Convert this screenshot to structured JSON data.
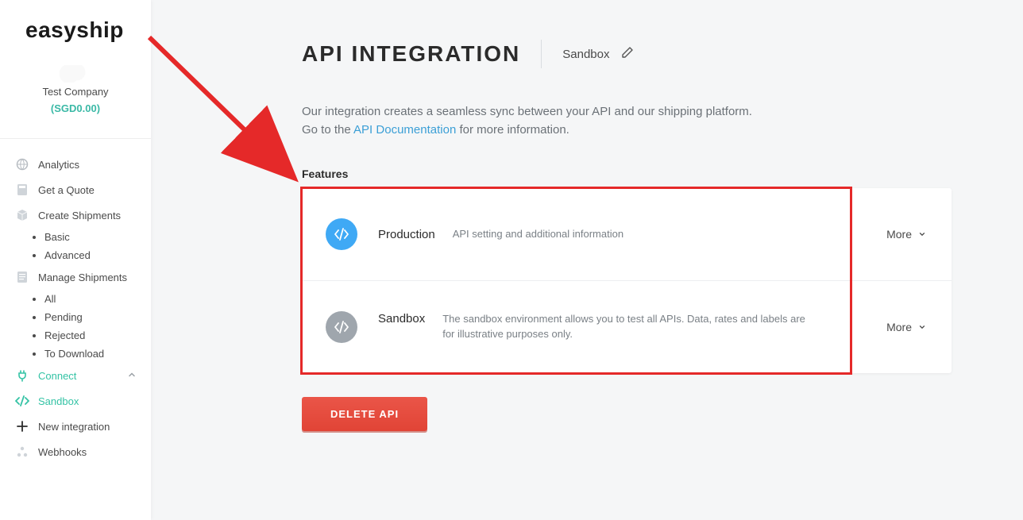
{
  "brand": "easyship",
  "company": {
    "name": "Test Company",
    "balance": "(SGD0.00)"
  },
  "sidebar": {
    "analytics": "Analytics",
    "quote": "Get a Quote",
    "create": "Create Shipments",
    "create_items": [
      "Basic",
      "Advanced"
    ],
    "manage": "Manage Shipments",
    "manage_items": [
      "All",
      "Pending",
      "Rejected",
      "To Download"
    ],
    "connect": "Connect",
    "sandbox": "Sandbox",
    "new_integration": "New integration",
    "webhooks": "Webhooks"
  },
  "page": {
    "title": "API INTEGRATION",
    "env_name": "Sandbox",
    "intro1": "Our integration creates a seamless sync between your API and our shipping platform.",
    "intro2_a": "Go to the ",
    "intro2_link": "API Documentation",
    "intro2_b": " for more information.",
    "features_label": "Features",
    "delete": "DELETE API"
  },
  "features": {
    "prod": {
      "title": "Production",
      "desc": "API setting and additional information",
      "more": "More"
    },
    "sand": {
      "title": "Sandbox",
      "desc": "The sandbox environment allows you to test all APIs. Data, rates and labels are for illustrative purposes only.",
      "more": "More"
    }
  },
  "colors": {
    "accent": "#34c3a5",
    "danger": "#e84c3d",
    "arrow": "#e52929"
  }
}
